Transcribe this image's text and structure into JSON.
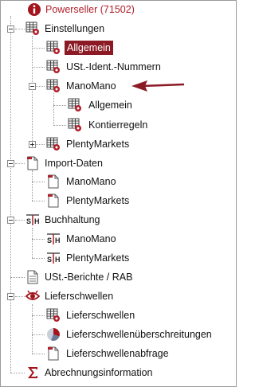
{
  "tree": {
    "root": {
      "label": "Powerseller (71502)",
      "icon": "info-icon"
    },
    "einstellungen": {
      "label": "Einstellungen",
      "icon": "grid-gear-icon",
      "children": {
        "allgemein": {
          "label": "Allgemein",
          "selected": true
        },
        "ust_ident": {
          "label": "USt.-Ident.-Nummern"
        },
        "manomano": {
          "label": "ManoMano",
          "children": {
            "allgemein": {
              "label": "Allgemein"
            },
            "kontierregeln": {
              "label": "Kontierregeln"
            }
          }
        },
        "plentymarkets": {
          "label": "PlentyMarkets"
        }
      }
    },
    "import_daten": {
      "label": "Import-Daten",
      "icon": "document-red-icon",
      "children": {
        "manomano": {
          "label": "ManoMano"
        },
        "plentymarkets": {
          "label": "PlentyMarkets"
        }
      }
    },
    "buchhaltung": {
      "label": "Buchhaltung",
      "icon": "sh-ledger-icon",
      "children": {
        "manomano": {
          "label": "ManoMano"
        },
        "plentymarkets": {
          "label": "PlentyMarkets"
        }
      }
    },
    "ust_berichte": {
      "label": "USt.-Berichte / RAB",
      "icon": "report-document-icon"
    },
    "lieferschwellen": {
      "label": "Lieferschwellen",
      "icon": "eye-icon",
      "children": {
        "lieferschwellen": {
          "label": "Lieferschwellen"
        },
        "ueberschreitungen": {
          "label": "Lieferschwellenüberschreitungen"
        },
        "abfrage": {
          "label": "Lieferschwellenabfrage"
        }
      }
    },
    "abrechnung": {
      "label": "Abrechnungsinformation",
      "icon": "sigma-icon"
    }
  },
  "colors": {
    "accent": "#8b1a24",
    "root_text": "#b0202a",
    "arrow": "#8b1a24"
  }
}
